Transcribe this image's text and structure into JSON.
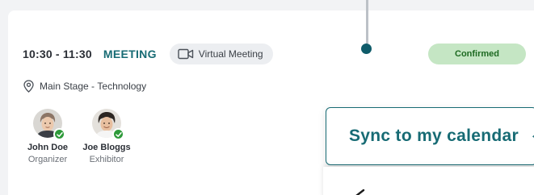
{
  "session": {
    "time": "10:30 - 11:30",
    "type": "MEETING",
    "format_label": "Virtual Meeting",
    "format_icon": "video-camera-icon",
    "status": "Confirmed",
    "location": {
      "stage": "Main Stage",
      "separator": "-",
      "track": "Technology",
      "icon": "map-pin-icon"
    }
  },
  "participants": [
    {
      "name": "John Doe",
      "role": "Organizer",
      "verified": true
    },
    {
      "name": "Joe Bloggs",
      "role": "Exhibitor",
      "verified": true
    }
  ],
  "sync_menu": {
    "label": "Sync to my calendar",
    "icon": "sync-icon"
  },
  "colors": {
    "accent": "#176b74",
    "status_bg": "#c5e6c4",
    "status_text": "#1e6a22",
    "check": "#2e9a3a"
  }
}
